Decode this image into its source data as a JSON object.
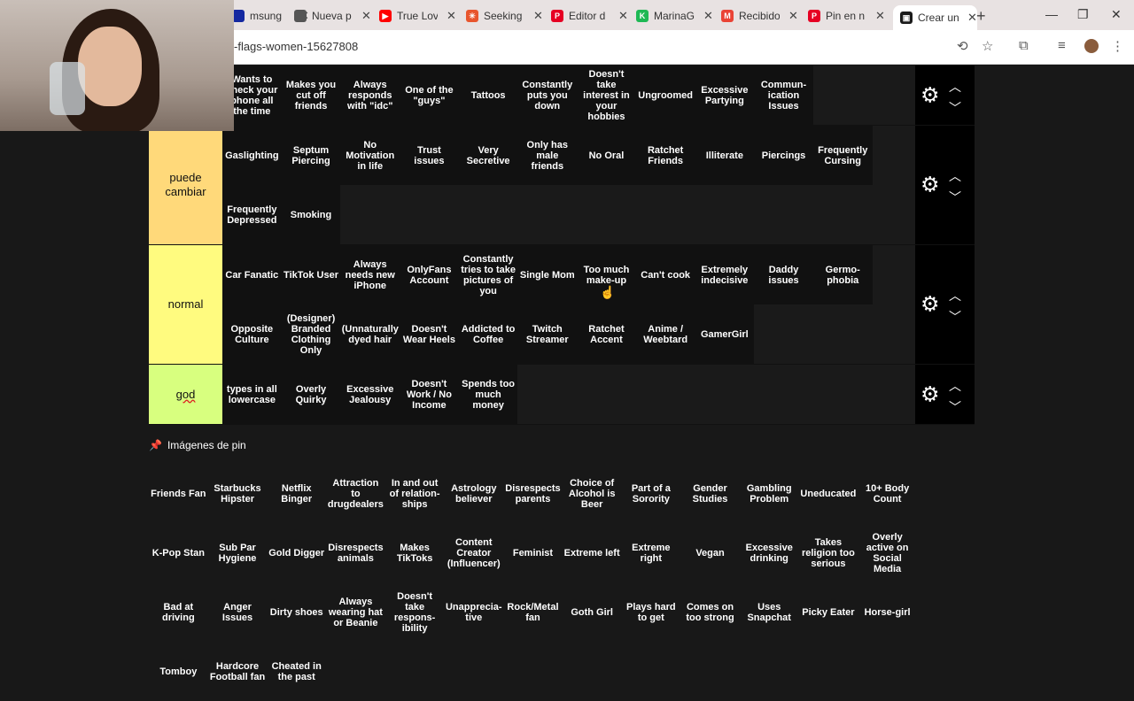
{
  "browser": {
    "tabs": [
      {
        "title": "msung",
        "color": "#1428a0",
        "glyph": ""
      },
      {
        "title": "Nueva p",
        "color": "#555555",
        "glyph": ""
      },
      {
        "title": "True Lov",
        "color": "#ff0000",
        "glyph": "▶"
      },
      {
        "title": "Seeking",
        "color": "#e8552d",
        "glyph": "✳"
      },
      {
        "title": "Editor d",
        "color": "#e60023",
        "glyph": "P"
      },
      {
        "title": "MarinaG",
        "color": "#1eb854",
        "glyph": "K"
      },
      {
        "title": "Recibido",
        "color": "#ea4335",
        "glyph": "M"
      },
      {
        "title": "Pin en n",
        "color": "#e60023",
        "glyph": "P"
      },
      {
        "title": "Crear un",
        "color": "#1a1a1a",
        "glyph": "▣"
      }
    ],
    "url": "-flags-women-15627808",
    "new_tab": "+",
    "minimize": "—",
    "restore": "❐",
    "close": "✕"
  },
  "tiers": [
    {
      "label": "",
      "color": "#000000",
      "items": [
        "Wants to check your phone all the time",
        "Makes you cut off friends",
        "Always responds with \"idc\"",
        "One of the \"guys\"",
        "Tattoos",
        "Constantly puts you down",
        "Doesn't take interest in your hobbies",
        "Ungroomed",
        "Excessive Partying",
        "Commun-ication Issues"
      ]
    },
    {
      "label": "puede cambiar",
      "color": "#ffd97a",
      "items": [
        "Gaslighting",
        "Septum Piercing",
        "No Motivation in life",
        "Trust issues",
        "Very Secretive",
        "Only has male friends",
        "No Oral",
        "Ratchet Friends",
        "Illiterate",
        "Piercings",
        "Frequently Cursing",
        "Frequently Depressed",
        "Smoking"
      ]
    },
    {
      "label": "normal",
      "color": "#fffb7f",
      "items": [
        "Car Fanatic",
        "TikTok User",
        "Always needs new iPhone",
        "OnlyFans Account",
        "Constantly tries to take pictures of you",
        "Single Mom",
        "Too much make-up",
        "Can't cook",
        "Extremely indecisive",
        "Daddy issues",
        "Germo-phobia",
        "Opposite Culture",
        "(Designer) Branded Clothing Only",
        "(Unnaturally dyed hair",
        "Doesn't Wear Heels",
        "Addicted to Coffee",
        "Twitch Streamer",
        "Ratchet Accent",
        "Anime / Weebtard",
        "GamerGirl"
      ]
    },
    {
      "label": "god",
      "color": "#d8ff7f",
      "items": [
        "types in all lowercase",
        "Overly Quirky",
        "Excessive Jealousy",
        "Doesn't Work / No Income",
        "Spends too much money"
      ]
    }
  ],
  "pin_images": {
    "header": "Imágenes de pin",
    "items": [
      "Friends Fan",
      "Starbucks Hipster",
      "Netflix Binger",
      "Attraction to drugdealers",
      "In and out of relation-ships",
      "Astrology believer",
      "Disrespects parents",
      "Choice of Alcohol is Beer",
      "Part of a Sorority",
      "Gender Studies",
      "Gambling Problem",
      "Uneducated",
      "10+ Body Count",
      "K-Pop Stan",
      "Sub Par Hygiene",
      "Gold Digger",
      "Disrespects animals",
      "Makes TikToks",
      "Content Creator (Influencer)",
      "Feminist",
      "Extreme left",
      "Extreme right",
      "Vegan",
      "Excessive drinking",
      "Takes religion too serious",
      "Overly active on Social Media",
      "Bad at driving",
      "Anger Issues",
      "Dirty shoes",
      "Always wearing hat or Beanie",
      "Doesn't take respons-ibility",
      "Unapprecia-tive",
      "Rock/Metal fan",
      "Goth Girl",
      "Plays hard to get",
      "Comes on too strong",
      "Uses Snapchat",
      "Picky Eater",
      "Horse-girl",
      "Tomboy",
      "Hardcore Football fan",
      "Cheated in the past"
    ]
  }
}
